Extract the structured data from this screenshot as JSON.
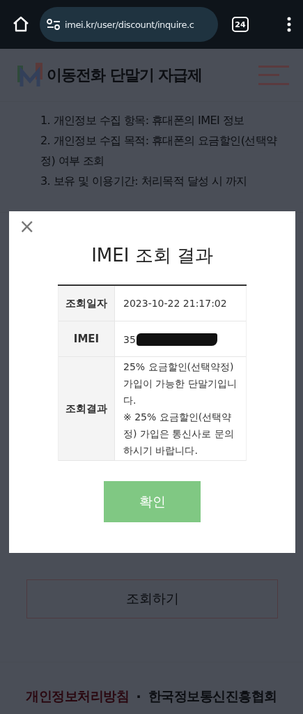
{
  "browser": {
    "url": "imei.kr/user/discount/inquire.c",
    "tab_count": "24"
  },
  "header": {
    "title": "이동전화 단말기 자급제"
  },
  "notice": [
    "1. 개인정보 수집 항목: 휴대폰의 IMEI 정보",
    "2. 개인정보 수집 목적: 휴대폰의 요금할인(선택약정) 여부 조회",
    "3. 보유 및 이용기간: 처리목적 달성 시 까지"
  ],
  "inquire_button": "조회하기",
  "footer": {
    "links": [
      {
        "label": "개인정보처리방침",
        "highlight": true
      },
      {
        "label": "한국정보통신진흥협회",
        "highlight": false
      }
    ],
    "separator": "·"
  },
  "dialog": {
    "close": "×",
    "title": "IMEI 조회 결과",
    "rows": [
      {
        "label": "조회일자",
        "value": [
          "2023-10-22 21:17:02"
        ],
        "redacted": false
      },
      {
        "label": "IMEI",
        "value": [
          "35"
        ],
        "redacted": true
      },
      {
        "label": "조회결과",
        "value": [
          "25% 요금할인(선택약정) 가입이 가능한 단말기입니다.",
          "※ 25% 요금할인(선택약정) 가입은 통신사로 문의하시기 바랍니다."
        ],
        "redacted": false
      }
    ],
    "confirm": "확인"
  }
}
